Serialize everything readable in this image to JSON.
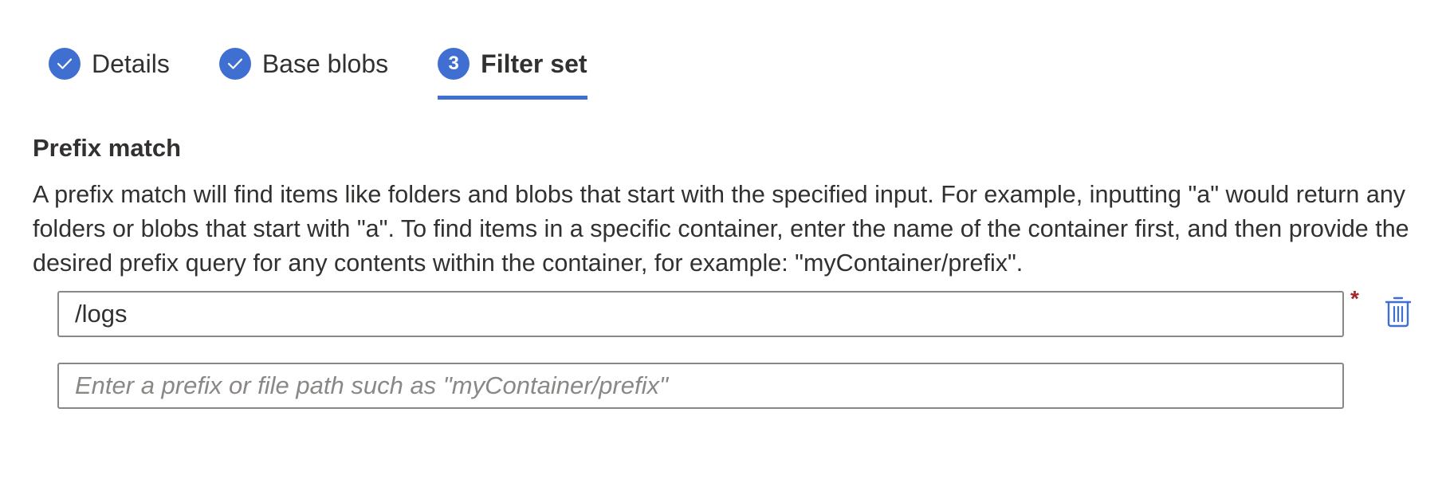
{
  "steps": [
    {
      "label": "Details",
      "state": "complete",
      "icon": "checkmark-icon"
    },
    {
      "label": "Base blobs",
      "state": "complete",
      "icon": "checkmark-icon"
    },
    {
      "label": "Filter set",
      "state": "active",
      "number": "3"
    }
  ],
  "section": {
    "title": "Prefix match",
    "description": "A prefix match will find items like folders and blobs that start with the specified input. For example, inputting \"a\" would return any folders or blobs that start with \"a\". To find items in a specific container, enter the name of the container first, and then provide the desired prefix query for any contents within the container, for example: \"myContainer/prefix\"."
  },
  "inputs": [
    {
      "value": "/logs",
      "required_marker": "*",
      "delete_icon": "trash-icon"
    },
    {
      "value": "",
      "placeholder": "Enter a prefix or file path such as \"myContainer/prefix\""
    }
  ],
  "colors": {
    "accent": "#3f6fd1",
    "required": "#a4262c",
    "border": "#8a8886",
    "text": "#323130"
  }
}
